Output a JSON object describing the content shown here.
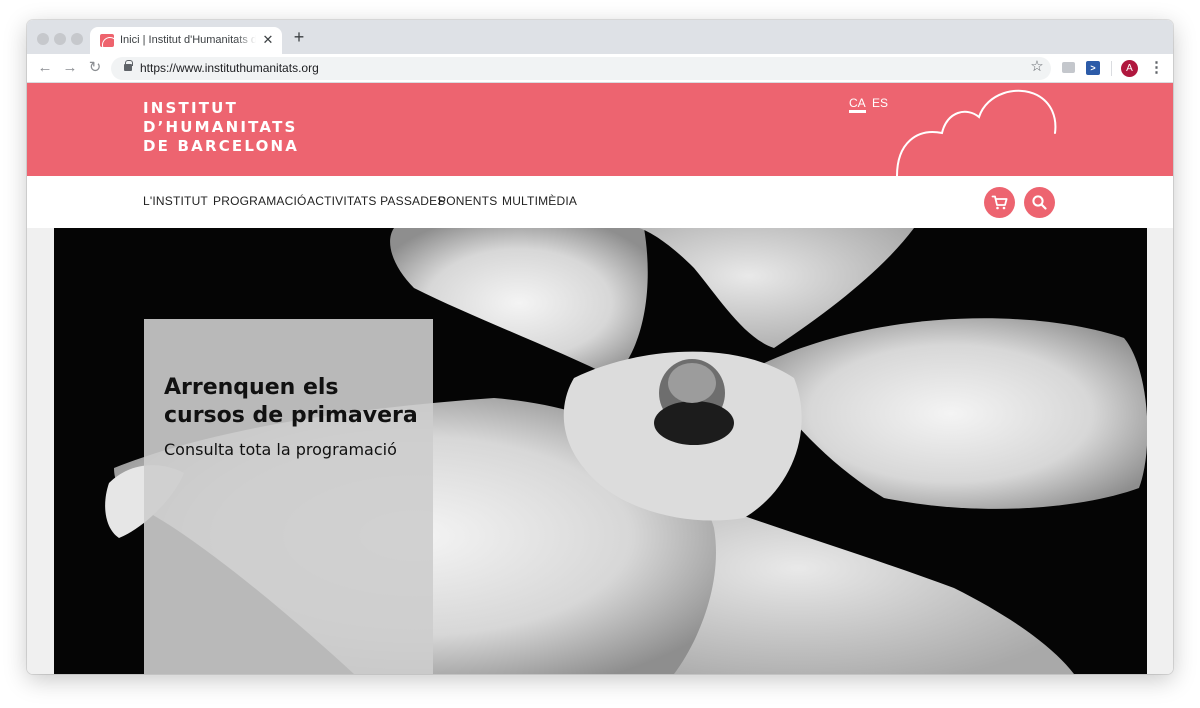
{
  "browser": {
    "tab_title": "Inici | Institut d'Humanitats de Barcelona",
    "tab_close": "✕",
    "new_tab": "+",
    "url": "https://www.instituthumanitats.org",
    "avatar_initial": "A",
    "icons": [
      "back-icon",
      "forward-icon",
      "reload-icon",
      "lock-icon",
      "star-icon",
      "extension-icon",
      "extension-arrow-icon",
      "more-menu-icon"
    ]
  },
  "site": {
    "logo_lines": [
      "INSTITUT",
      "D’HUMANITATS",
      "DE BARCELONA"
    ],
    "languages": [
      {
        "label": "CA",
        "active": true
      },
      {
        "label": "ES",
        "active": false
      }
    ],
    "nav": [
      "L'INSTITUT",
      "PROGRAMACIÓ",
      "ACTIVITATS PASSADES",
      "PONENTS",
      "MULTIMÈDIA"
    ],
    "actions": [
      "cart-icon",
      "search-icon"
    ],
    "colors": {
      "brand": "#ed6470",
      "text": "#222222"
    }
  },
  "hero": {
    "title": "Arrenquen els cursos de primavera",
    "subtitle": "Consulta tota la programació",
    "image": "black-and-white photo of a dancer in flowing white fabric seen from above"
  }
}
